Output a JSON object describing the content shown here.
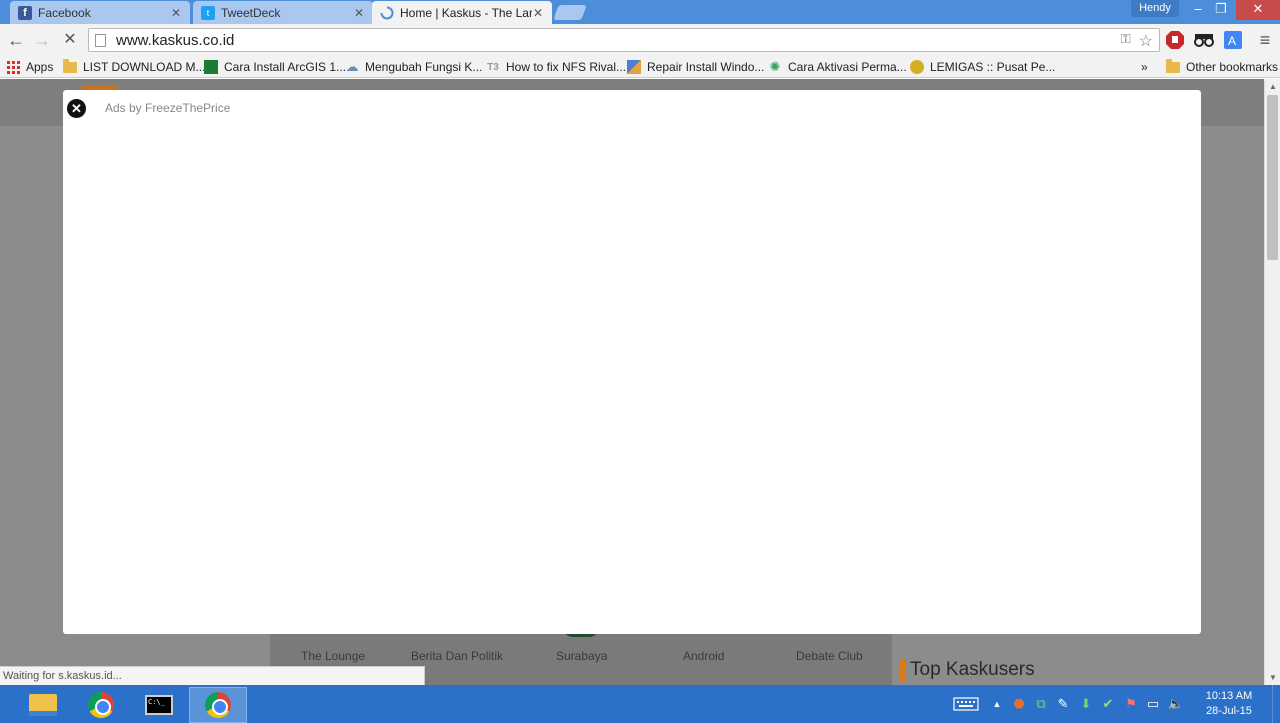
{
  "browser": {
    "tabs": [
      {
        "label": "Facebook",
        "icon": "facebook-icon",
        "active": false
      },
      {
        "label": "TweetDeck",
        "icon": "twitter-icon",
        "active": false
      },
      {
        "label": "Home | Kaskus - The Larg",
        "icon": "loading-spinner-icon",
        "active": true
      }
    ],
    "profile_name": "Hendy",
    "window_controls": {
      "minimize": "–",
      "restore": "❐",
      "close": "✕"
    },
    "address": "www.kaskus.co.id",
    "status_text": "Waiting for s.kaskus.id..."
  },
  "bookmarks": {
    "apps_label": "Apps",
    "items": [
      {
        "label": "LIST DOWNLOAD M...",
        "icon": "folder-icon"
      },
      {
        "label": "Cara Install ArcGIS 1...",
        "icon": "green-square-icon"
      },
      {
        "label": "Mengubah Fungsi K...",
        "icon": "cloud-icon"
      },
      {
        "label": "How to fix NFS Rival...",
        "icon": "t3-icon"
      },
      {
        "label": "Repair Install Windo...",
        "icon": "colorful-square-icon"
      },
      {
        "label": "Cara Aktivasi Perma...",
        "icon": "gear-star-icon"
      },
      {
        "label": "LEMIGAS :: Pusat Pe...",
        "icon": "emblem-icon"
      }
    ],
    "overflow": "»",
    "other_label": "Other bookmarks"
  },
  "ad": {
    "label": "Ads by FreezeThePrice",
    "close_symbol": "✕"
  },
  "page": {
    "categories": [
      "The Lounge",
      "Berita Dan Politik",
      "Surabaya",
      "Android",
      "Debate Club"
    ],
    "section_title": "Top Kaskusers"
  },
  "taskbar": {
    "apps": [
      {
        "name": "file-explorer",
        "active": false
      },
      {
        "name": "chrome",
        "active": false
      },
      {
        "name": "command-prompt",
        "active": false
      },
      {
        "name": "chrome",
        "active": true
      }
    ],
    "clock_time": "10:13 AM",
    "clock_date": "28-Jul-15"
  },
  "colors": {
    "tabstrip": "#4d8edb",
    "taskbar": "#2b70c9",
    "page_dimmed": "#8c8c8c",
    "kaskus_orange": "#d97a16"
  }
}
